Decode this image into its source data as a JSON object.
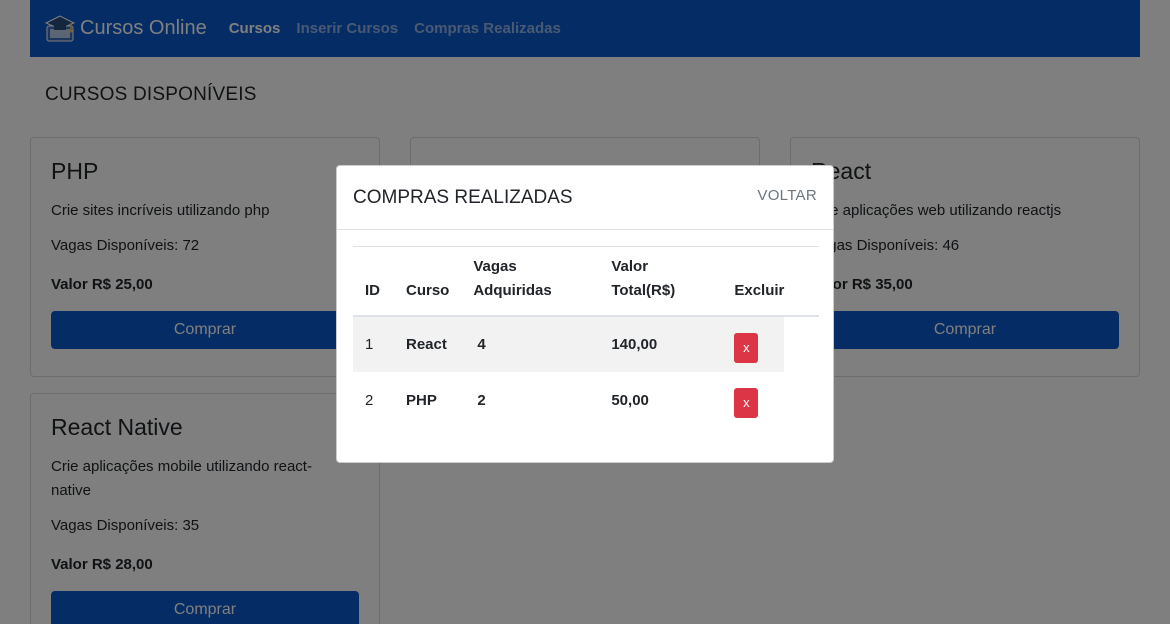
{
  "navbar": {
    "brand": "Cursos Online",
    "links": [
      "Cursos",
      "Inserir Cursos",
      "Compras Realizadas"
    ]
  },
  "page": {
    "heading": "CURSOS DISPONÍVEIS"
  },
  "cards": [
    {
      "title": "PHP",
      "description": "Crie sites incríveis utilizando php",
      "vagas": "Vagas Disponíveis: 72",
      "valor": "Valor R$ 25,00",
      "button": "Comprar"
    },
    {
      "title": "React",
      "description": "Crie aplicações web utilizando reactjs",
      "vagas": "Vagas Disponíveis: 46",
      "valor": "Valor R$ 35,00",
      "button": "Comprar"
    },
    {
      "title": "React Native",
      "description": "Crie aplicações mobile utilizando react-native",
      "vagas": "Vagas Disponíveis: 35",
      "valor": "Valor R$ 28,00",
      "button": "Comprar"
    }
  ],
  "modal": {
    "title": "COMPRAS REALIZADAS",
    "close_label": "VOLTAR",
    "columns": [
      "ID",
      "Curso",
      "Vagas Adquiridas",
      "Valor Total(R$)",
      "Excluir"
    ],
    "rows": [
      {
        "id": "1",
        "curso": "React",
        "vagas": "4",
        "valor": "140,00",
        "excluir": "x"
      },
      {
        "id": "2",
        "curso": "PHP",
        "vagas": "2",
        "valor": "50,00",
        "excluir": "x"
      }
    ]
  },
  "colors": {
    "primary": "#0a58ca",
    "danger": "#dc3545",
    "overlay": "rgba(0,0,0,0.5)"
  },
  "icons": {
    "brand": "graduation-cap-icon"
  }
}
